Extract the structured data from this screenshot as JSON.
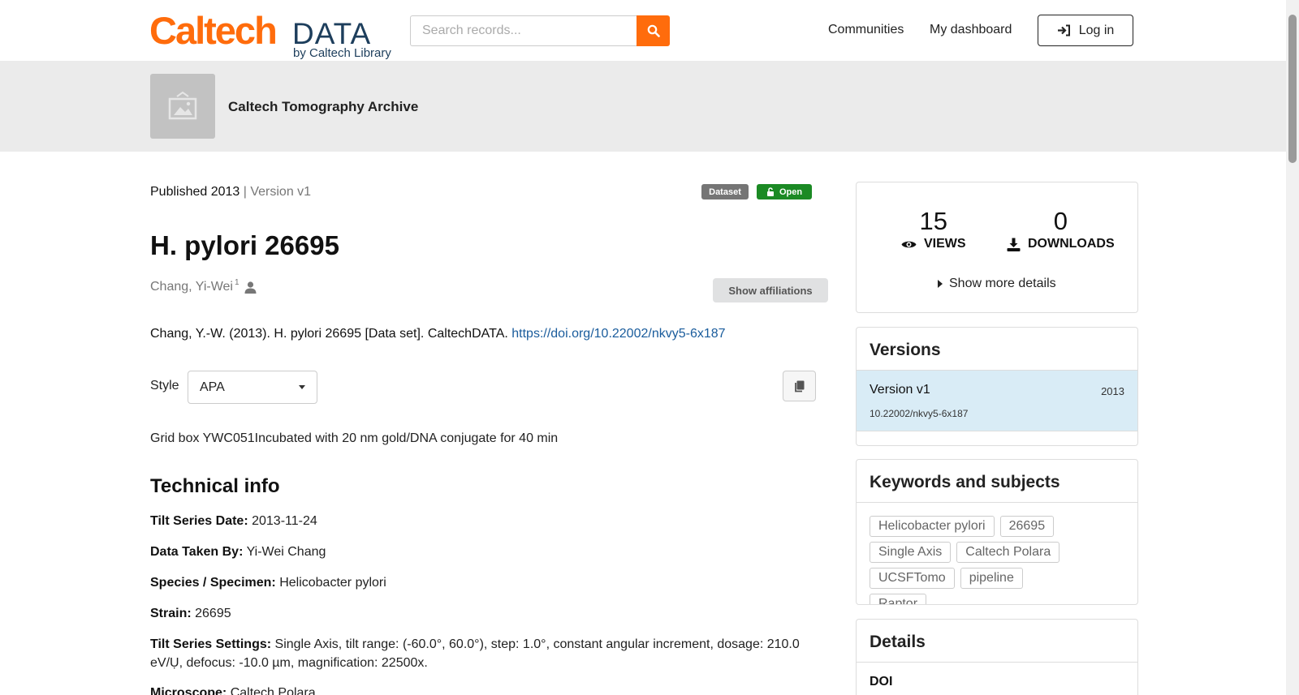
{
  "header": {
    "logo_main": "Caltech",
    "logo_data": "DATA",
    "logo_by": "by Caltech Library",
    "search_placeholder": "Search records...",
    "nav": [
      "Communities",
      "My dashboard"
    ],
    "login_label": "Log in"
  },
  "community": {
    "name": "Caltech Tomography Archive"
  },
  "record": {
    "published": "Published 2013",
    "version_sep": " | ",
    "version": "Version v1",
    "badge_type": "Dataset",
    "badge_access": "Open",
    "title": "H. pylori 26695",
    "creator": "Chang, Yi-Wei",
    "creator_sup": "1",
    "affiliations_button": "Show affiliations",
    "citation_text": "Chang, Y.-W. (2013). H. pylori 26695 [Data set]. CaltechDATA. ",
    "citation_link": "https://doi.org/10.22002/nkvy5-6x187",
    "style_label": "Style",
    "style_value": "APA",
    "description": "Grid box YWC051Incubated with 20 nm gold/DNA conjugate for 40 min"
  },
  "technical": {
    "title": "Technical info",
    "items": [
      {
        "label": "Tilt Series Date:",
        "value": "2013-11-24"
      },
      {
        "label": "Data Taken By:",
        "value": "Yi-Wei Chang"
      },
      {
        "label": "Species / Specimen:",
        "value": "Helicobacter pylori"
      },
      {
        "label": "Strain:",
        "value": "26695"
      },
      {
        "label": "Tilt Series Settings:",
        "value": "Single Axis, tilt range: (-60.0°, 60.0°), step: 1.0°, constant angular increment, dosage: 210.0 eV/Ụ, defocus: -10.0 µm, magnification: 22500x."
      },
      {
        "label": "Microscope:",
        "value": "Caltech Polara"
      }
    ]
  },
  "stats": {
    "views": "15",
    "views_label": "VIEWS",
    "downloads": "0",
    "downloads_label": "DOWNLOADS",
    "more": "Show more details"
  },
  "versions": {
    "title": "Versions",
    "items": [
      {
        "name": "Version v1",
        "year": "2013",
        "doi": "10.22002/nkvy5-6x187"
      }
    ]
  },
  "keywords": {
    "title": "Keywords and subjects",
    "items": [
      "Helicobacter pylori",
      "26695",
      "Single Axis",
      "Caltech Polara",
      "UCSFTomo",
      "pipeline",
      "Raptor"
    ]
  },
  "details": {
    "title": "Details",
    "doi_label": "DOI"
  },
  "colors": {
    "brand_orange": "#ff6c0c",
    "brand_navy": "#1d3e5c",
    "open_green": "#1b8a24",
    "link": "#1a5c9c"
  }
}
